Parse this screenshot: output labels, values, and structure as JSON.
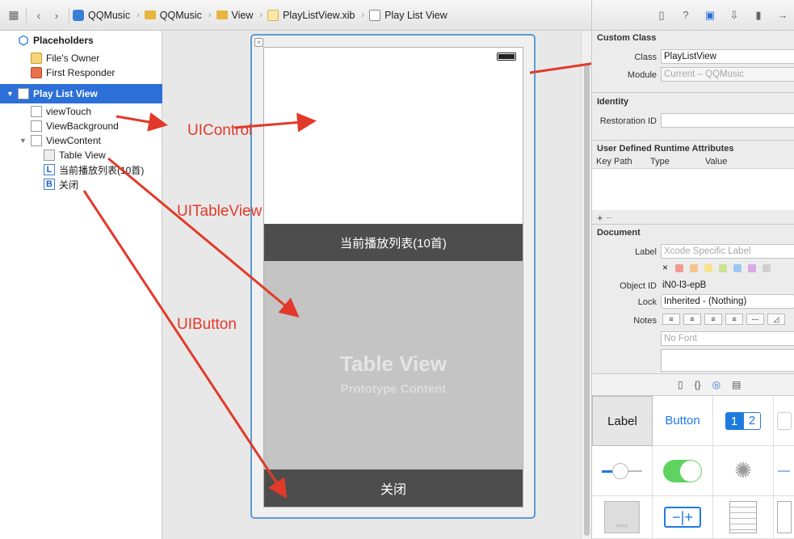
{
  "jumpbar": {
    "crumbs": [
      "QQMusic",
      "QQMusic",
      "View",
      "PlayListView.xib",
      "Play List View"
    ]
  },
  "outline": {
    "placeholders": "Placeholders",
    "files_owner": "File's Owner",
    "first_responder": "First Responder",
    "play_list_view": "Play List View",
    "view_touch": "viewTouch",
    "view_background": "ViewBackground",
    "view_content": "ViewContent",
    "table_view": "Table View",
    "label_item": "当前播放列表(10首)",
    "button_item": "关闭",
    "label_letter": "L",
    "button_letter": "B"
  },
  "canvas": {
    "title_bar_text": "当前播放列表(10首)",
    "table_view_title": "Table View",
    "table_view_subtitle": "Prototype Content",
    "close_bar_text": "关闭"
  },
  "annotations": {
    "uicontrol": "UIControl",
    "uitableview": "UITableView",
    "uibutton": "UIButton"
  },
  "inspector": {
    "custom_class": {
      "title": "Custom Class",
      "class_label": "Class",
      "class_value": "PlayListView",
      "module_label": "Module",
      "module_placeholder": "Current – QQMusic"
    },
    "identity": {
      "title": "Identity",
      "restoration_label": "Restoration ID"
    },
    "runtime_attrs": {
      "title": "User Defined Runtime Attributes",
      "col_key": "Key Path",
      "col_type": "Type",
      "col_value": "Value"
    },
    "document": {
      "title": "Document",
      "label_label": "Label",
      "label_placeholder": "Xcode Specific Label",
      "clear_mark": "×",
      "object_id_label": "Object ID",
      "object_id_value": "iN0-l3-epB",
      "lock_label": "Lock",
      "lock_value": "Inherited - (Nothing)",
      "notes_label": "Notes",
      "font_placeholder": "No Font"
    },
    "swatch_colors": [
      "#f29a92",
      "#f6c48c",
      "#f5e38a",
      "#c9e28c",
      "#9cc7f2",
      "#d7a7e8",
      "#cfcfcf"
    ],
    "library": {
      "label_tile": "Label",
      "button_tile": "Button",
      "seg_1": "1",
      "seg_2": "2"
    }
  },
  "colors": {
    "annotation": "#e23a2a",
    "selection": "#2d6fd8",
    "dark_bar": "#4d4d4d"
  }
}
